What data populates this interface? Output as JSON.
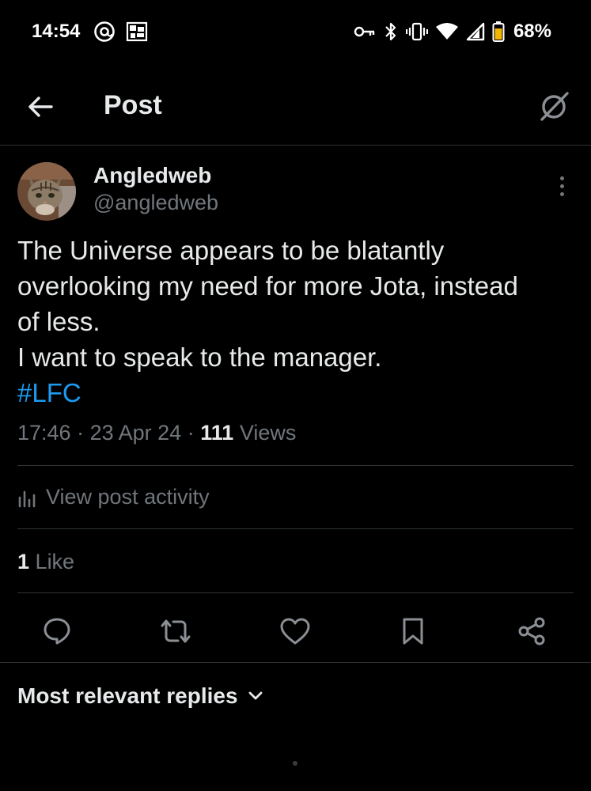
{
  "status_bar": {
    "time": "14:54",
    "battery_text": "68%",
    "icons": [
      "threads-icon",
      "pixel-grid-icon",
      "vpn-key-icon",
      "bluetooth-icon",
      "vibrate-icon",
      "wifi-icon",
      "cellular-signal-icon",
      "battery-icon"
    ]
  },
  "header": {
    "title": "Post",
    "back_icon": "arrow-left-icon",
    "grok_icon": "grok-icon"
  },
  "post": {
    "author": {
      "display_name": "Angledweb",
      "handle": "@angledweb"
    },
    "text_lines": [
      "The Universe appears to be blatantly",
      "overlooking my need for more Jota, instead",
      "of less.",
      "I want to speak to the manager."
    ],
    "hashtag": "#LFC",
    "time": "17:46",
    "date": "23 Apr 24",
    "views_count": "111",
    "views_label": "Views",
    "separator": "·"
  },
  "activity": {
    "label": "View post activity"
  },
  "likes": {
    "count": "1",
    "label": "Like"
  },
  "actions": [
    "reply",
    "repost",
    "like",
    "bookmark",
    "share"
  ],
  "replies": {
    "filter_label": "Most relevant replies"
  },
  "colors": {
    "background": "#000000",
    "text_primary": "#e7e9ea",
    "text_secondary": "#71767b",
    "accent": "#1d9bf0",
    "divider": "#2f3336"
  }
}
